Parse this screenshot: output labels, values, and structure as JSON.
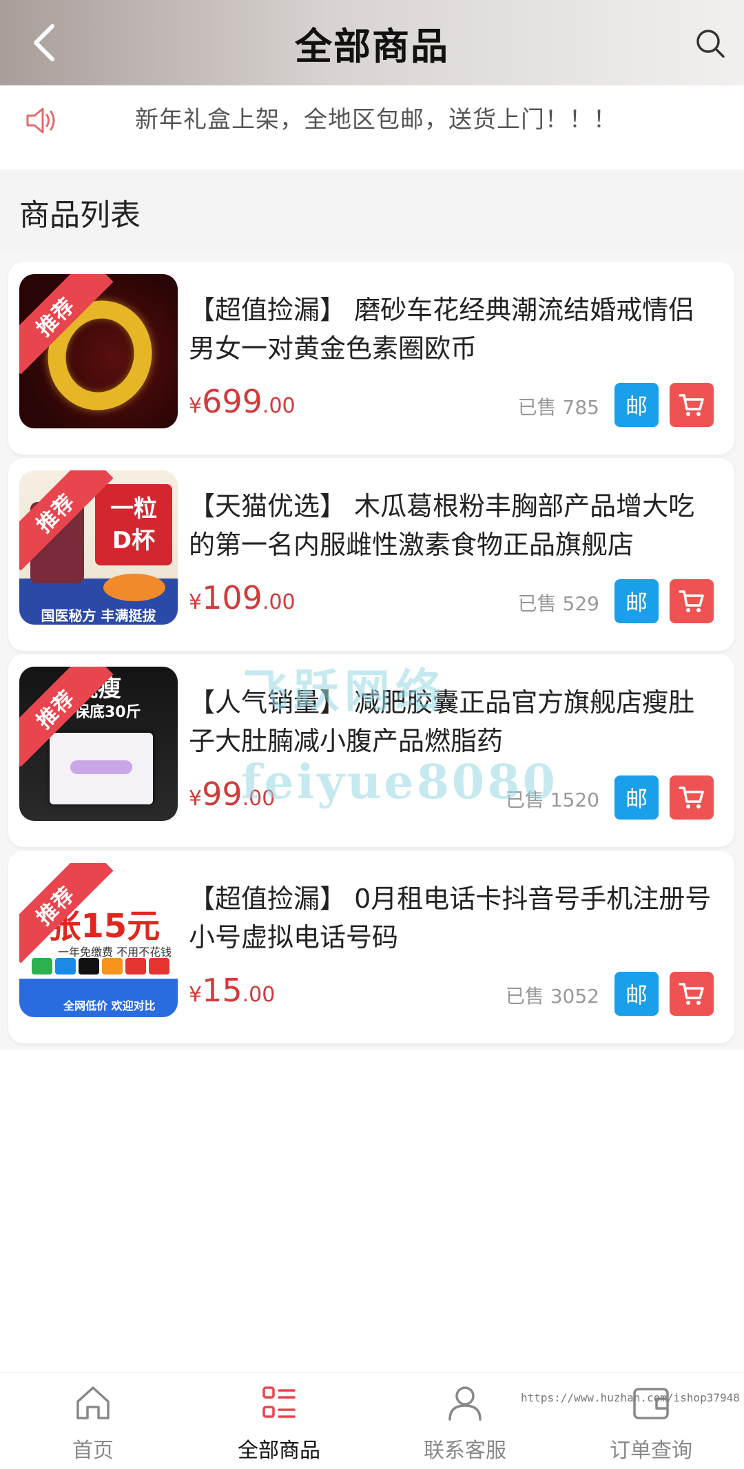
{
  "header": {
    "title": "全部商品",
    "back_icon": "chevron-left-icon",
    "search_icon": "search-icon"
  },
  "notice": {
    "icon": "speaker-icon",
    "text": "新年礼盒上架，全地区包邮，送货上门！！！"
  },
  "section": {
    "title": "商品列表"
  },
  "products": [
    {
      "badge": "推荐",
      "title": "【超值捡漏】 磨砂车花经典潮流结婚戒情侣男女一对黄金色素圈欧币",
      "price_symbol": "¥",
      "price_int": "699",
      "price_dec": ".00",
      "sold": "已售 785",
      "mail_label": "邮"
    },
    {
      "badge": "推荐",
      "title": "【天猫优选】 木瓜葛根粉丰胸部产品增大吃的第一名内服雌性激素食物正品旗舰店",
      "price_symbol": "¥",
      "price_int": "109",
      "price_dec": ".00",
      "sold": "已售 529",
      "mail_label": "邮",
      "art": {
        "tag1": "一粒",
        "tag2": "D杯",
        "foot": "国医秘方 丰满挺拔"
      }
    },
    {
      "badge": "推荐",
      "title": "【人气销量】 减肥胶囊正品官方旗舰店瘦肚子大肚腩减小腹产品燃脂药",
      "price_symbol": "¥",
      "price_int": "99",
      "price_dec": ".00",
      "sold": "已售 1520",
      "mail_label": "邮",
      "art": {
        "top": "就瘦",
        "sub": "保底30斤"
      }
    },
    {
      "badge": "推荐",
      "title": "【超值捡漏】 0月租电话卡抖音号手机注册号小号虚拟电话号码",
      "price_symbol": "¥",
      "price_int": "15",
      "price_dec": ".00",
      "sold": "已售 3052",
      "mail_label": "邮",
      "art": {
        "big": "9张15元",
        "line": "一年免缴费 不用不花钱",
        "bot": "全网低价 欢迎对比"
      }
    }
  ],
  "watermark": {
    "line1": "飞跃网络",
    "line2": "feiyue8080"
  },
  "url_watermark": "https://www.huzhan.com/ishop37948",
  "tabbar": [
    {
      "label": "首页",
      "icon": "home-icon",
      "active": false
    },
    {
      "label": "全部商品",
      "icon": "list-icon",
      "active": true
    },
    {
      "label": "联系客服",
      "icon": "user-icon",
      "active": false
    },
    {
      "label": "订单查询",
      "icon": "wallet-icon",
      "active": false
    }
  ],
  "colors": {
    "price": "#d33a3a",
    "mail_button": "#1a9fea",
    "cart_button": "#ef5253",
    "badge": "#e8454e",
    "active_tab_icon": "#e8454e"
  }
}
